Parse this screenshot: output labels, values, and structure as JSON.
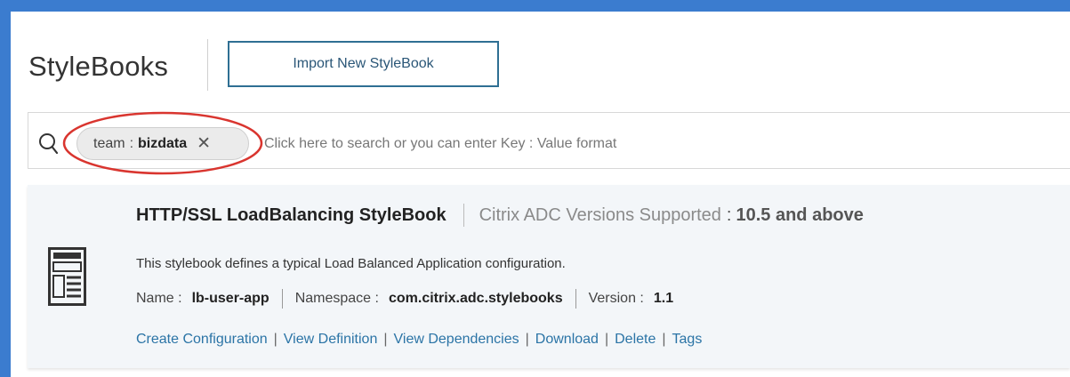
{
  "header": {
    "title": "StyleBooks",
    "import_button_label": "Import New StyleBook"
  },
  "search": {
    "placeholder": "Click here to search or you can enter Key : Value format",
    "value": "",
    "chip": {
      "key": "team",
      "separator": ":",
      "value": "bizdata",
      "close_glyph": "✕"
    }
  },
  "card": {
    "title": "HTTP/SSL LoadBalancing StyleBook",
    "versions_label": "Citrix ADC Versions Supported",
    "versions_separator": ":",
    "versions_value": "10.5 and above",
    "description": "This stylebook defines a typical Load Balanced Application configuration.",
    "meta": {
      "name_label": "Name :",
      "name_value": "lb-user-app",
      "namespace_label": "Namespace :",
      "namespace_value": "com.citrix.adc.stylebooks",
      "version_label": "Version :",
      "version_value": "1.1"
    },
    "actions": [
      "Create Configuration",
      "View Definition",
      "View Dependencies",
      "Download",
      "Delete",
      "Tags"
    ],
    "action_separator": "|"
  },
  "icons": {
    "search": "search-icon",
    "stylebook": "stylebook-document-icon",
    "chip_close": "close-icon"
  },
  "colors": {
    "frame": "#3b7ccf",
    "button_border": "#2f6f93",
    "link": "#2b74a6",
    "highlight": "#d9352f",
    "card_background": "#f3f6f9"
  }
}
